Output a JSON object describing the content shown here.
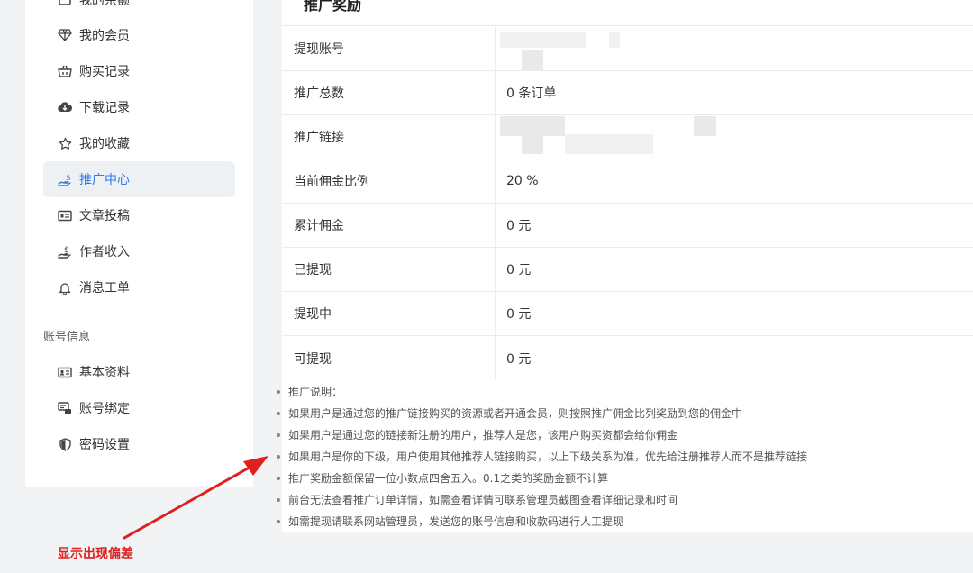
{
  "sidebar": {
    "items_top": [
      {
        "label": "我的余额",
        "icon": "wallet-icon"
      },
      {
        "label": "我的会员",
        "icon": "diamond-icon"
      },
      {
        "label": "购买记录",
        "icon": "basket-icon"
      },
      {
        "label": "下载记录",
        "icon": "cloud-download-icon"
      },
      {
        "label": "我的收藏",
        "icon": "star-icon"
      },
      {
        "label": "推广中心",
        "icon": "hand-coin-icon"
      },
      {
        "label": "文章投稿",
        "icon": "article-icon"
      },
      {
        "label": "作者收入",
        "icon": "income-icon"
      },
      {
        "label": "消息工单",
        "icon": "bell-icon"
      }
    ],
    "section_account": "账号信息",
    "items_account": [
      {
        "label": "基本资料",
        "icon": "id-card-icon"
      },
      {
        "label": "账号绑定",
        "icon": "link-account-icon"
      },
      {
        "label": "密码设置",
        "icon": "shield-icon"
      }
    ],
    "active_label": "推广中心",
    "accent_color": "#2f7be8"
  },
  "panel": {
    "title": "推广奖励",
    "rows": [
      {
        "label": "提现账号",
        "value": ""
      },
      {
        "label": "推广总数",
        "value": "0 条订单"
      },
      {
        "label": "推广链接",
        "value": ""
      },
      {
        "label": "当前佣金比例",
        "value": "20 %"
      },
      {
        "label": "累计佣金",
        "value": "0 元"
      },
      {
        "label": "已提现",
        "value": "0 元"
      },
      {
        "label": "提现中",
        "value": "0 元"
      },
      {
        "label": "可提现",
        "value": "0 元"
      }
    ]
  },
  "notes": [
    "推广说明：",
    "如果用户是通过您的推广链接购买的资源或者开通会员，则按照推广佣金比列奖励到您的佣金中",
    "如果用户是通过您的链接新注册的用户，推荐人是您，该用户购买资都会给你佣金",
    "如果用户是你的下级，用户使用其他推荐人链接购买，以上下级关系为准，优先给注册推荐人而不是推荐链接",
    "推广奖励金额保留一位小数点四舍五入。0.1之类的奖励金额不计算",
    "前台无法查看推广订单详情，如需查看详情可联系管理员截图查看详细记录和时间",
    "如需提现请联系网站管理员，发送您的账号信息和收款码进行人工提现"
  ],
  "annotation": {
    "text": "显示出现偏差",
    "color": "#e02020"
  }
}
